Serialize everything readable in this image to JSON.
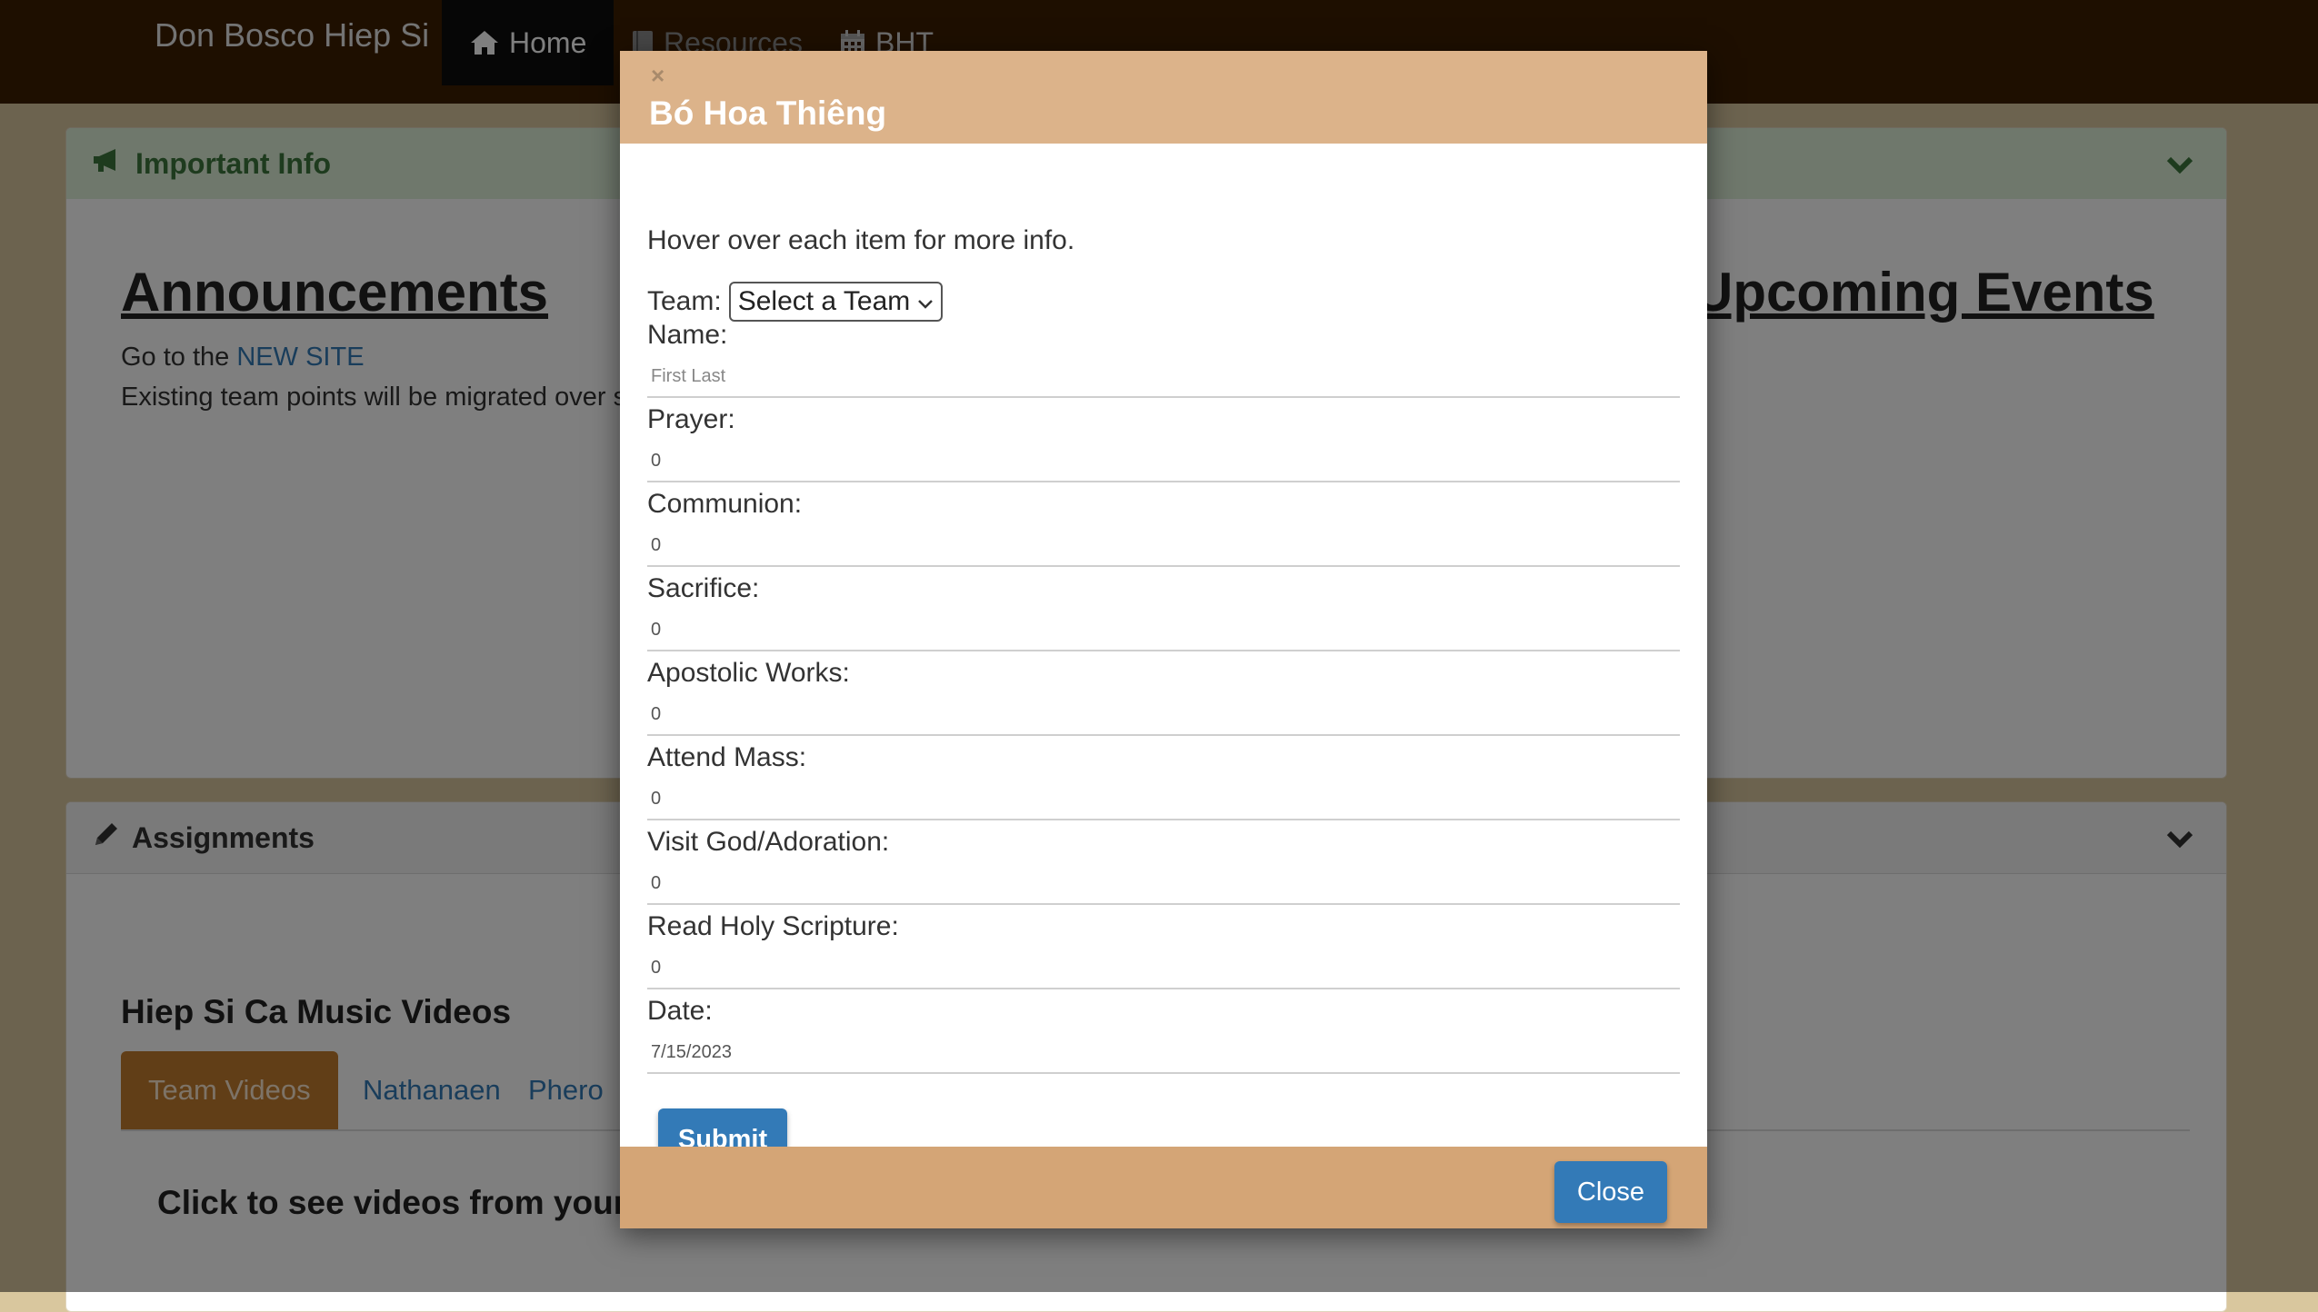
{
  "navbar": {
    "brand": "Don Bosco Hiep Si",
    "items": [
      {
        "label": "Home",
        "icon": "home-icon",
        "active": true
      },
      {
        "label": "Resources",
        "icon": "book-icon"
      },
      {
        "label": "BHT",
        "icon": "calendar-icon"
      }
    ]
  },
  "important_panel": {
    "heading": "Important Info",
    "announcements_title": "Announcements",
    "line1_prefix": "Go to the ",
    "line1_link": "NEW SITE",
    "line2": "Existing team points will be migrated over so",
    "events_title": "Upcoming Events"
  },
  "assignments_panel": {
    "heading": "Assignments",
    "videos_title": "Hiep Si Ca Music Videos",
    "tabs": [
      "Team Videos",
      "Nathanaen",
      "Phero"
    ],
    "click_text": "Click to see videos from your f"
  },
  "modal": {
    "title": "Bó Hoa Thiêng",
    "close_x": "×",
    "hover_note": "Hover over each item for more info.",
    "team_label": "Team:",
    "team_select_value": "Select a Team",
    "fields": [
      {
        "label": "Name:",
        "placeholder": "First Last",
        "value": ""
      },
      {
        "label": "Prayer:",
        "value": "0"
      },
      {
        "label": "Communion:",
        "value": "0"
      },
      {
        "label": "Sacrifice:",
        "value": "0"
      },
      {
        "label": "Apostolic Works:",
        "value": "0"
      },
      {
        "label": "Attend Mass:",
        "value": "0"
      },
      {
        "label": "Visit God/Adoration:",
        "value": "0"
      },
      {
        "label": "Read Holy Scripture:",
        "value": "0"
      },
      {
        "label": "Date:",
        "value": "7/15/2023"
      }
    ],
    "submit_label": "Submit",
    "close_label": "Close"
  },
  "colors": {
    "navbar": "#3d1f00",
    "modal_header": "#dcb38a",
    "modal_footer": "#d4a576",
    "primary_button": "#337ab7",
    "active_tab": "#c27c2e"
  }
}
